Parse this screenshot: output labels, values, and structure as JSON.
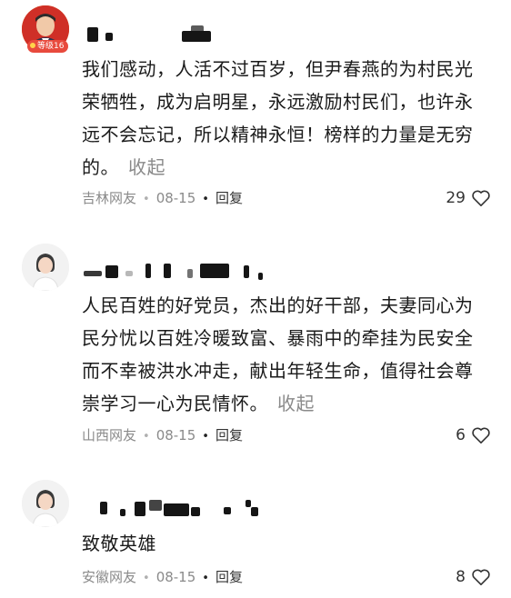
{
  "comments": [
    {
      "level_badge": "等级16",
      "text": "我们感动，人活不过百岁，但尹春燕的为村民光荣牺牲，成为启明星，永远激励村民们，也许永远不会忘记，所以精神永恒！榜样的力量是无穷的。",
      "collapse_label": "收起",
      "location": "吉林网友",
      "date": "08-15",
      "reply_label": "回复",
      "likes": "29"
    },
    {
      "text": "人民百姓的好党员，杰出的好干部，夫妻同心为民分忧以百姓冷暖致富、暴雨中的牵挂为民安全而不幸被洪水冲走，献出年轻生命，值得社会尊崇学习一心为民情怀。",
      "collapse_label": "收起",
      "location": "山西网友",
      "date": "08-15",
      "reply_label": "回复",
      "likes": "6"
    },
    {
      "text": "致敬英雄",
      "location": "安徽网友",
      "date": "08-15",
      "reply_label": "回复",
      "likes": "8"
    }
  ],
  "separator": "•",
  "icons": {
    "like": "heart-outline-icon",
    "avatar_default": "default-user-icon"
  },
  "colors": {
    "meta": "#8a8a8a",
    "badge": "#e84a3d",
    "text": "#1a1a1a"
  }
}
